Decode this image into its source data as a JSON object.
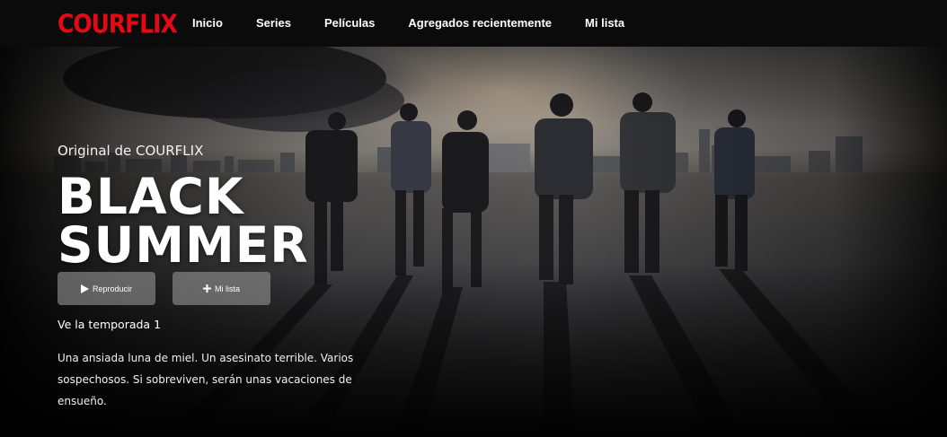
{
  "brand": {
    "logo": "COURFLIX",
    "accent": "#e50914"
  },
  "nav": {
    "items": [
      {
        "label": "Inicio"
      },
      {
        "label": "Series"
      },
      {
        "label": "Películas"
      },
      {
        "label": "Agregados recientemente"
      },
      {
        "label": "Mi lista"
      }
    ]
  },
  "hero": {
    "original_label": "Original de COURFLIX",
    "title_line1": "BLACK",
    "title_line2": "SUMMER",
    "play_label": "Reproducir",
    "play_icon": "play-icon",
    "list_label": "Mi lista",
    "list_icon": "plus-icon",
    "season_text": "Ve la temporada 1",
    "synopsis": "Una ansiada luna de miel. Un asesinato terrible. Varios sospechosos. Si sobreviven, serán unas vacaciones de ensueño."
  }
}
